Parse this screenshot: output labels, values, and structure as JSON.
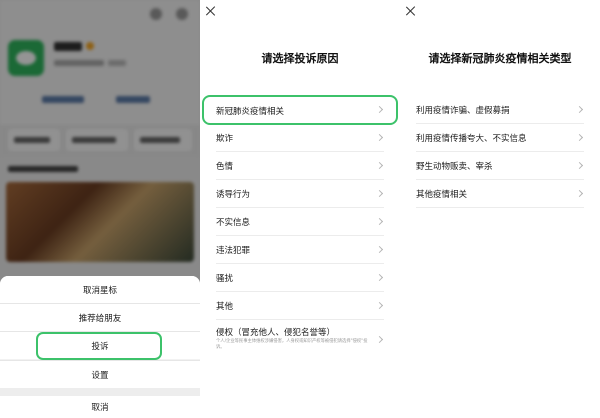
{
  "panel1": {
    "sheet_items": [
      "取消星标",
      "推荐给朋友",
      "投诉",
      "设置"
    ],
    "cancel_label": "取消"
  },
  "panel2": {
    "title": "请选择投诉原因",
    "reasons": [
      {
        "label": "新冠肺炎疫情相关"
      },
      {
        "label": "欺诈"
      },
      {
        "label": "色情"
      },
      {
        "label": "诱导行为"
      },
      {
        "label": "不实信息"
      },
      {
        "label": "违法犯罪"
      },
      {
        "label": "骚扰"
      },
      {
        "label": "其他"
      },
      {
        "label": "侵权（冒充他人、侵犯名誉等）",
        "desc": "个人/企业等民事主体维权涉嫌侵害，人身权或知识产权等被侵犯请选择\"侵权\"投诉。"
      }
    ]
  },
  "panel3": {
    "title": "请选择新冠肺炎疫情相关类型",
    "types": [
      {
        "label": "利用疫情诈骗、虚假募捐"
      },
      {
        "label": "利用疫情传播夸大、不实信息"
      },
      {
        "label": "野生动物贩卖、宰杀"
      },
      {
        "label": "其他疫情相关"
      }
    ]
  },
  "colors": {
    "highlight": "#3cc26a",
    "wechat_green": "#2fb55d"
  }
}
